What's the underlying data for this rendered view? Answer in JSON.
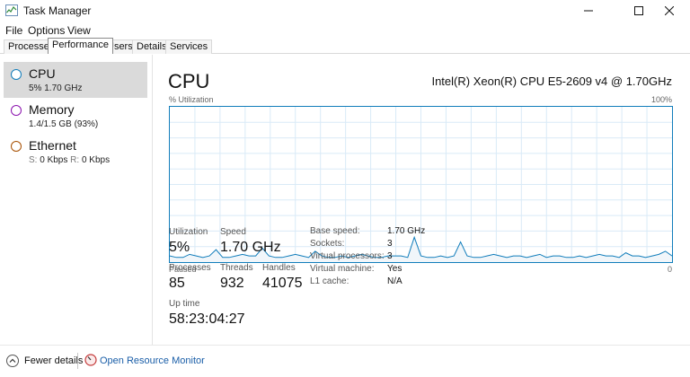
{
  "window": {
    "title": "Task Manager"
  },
  "menu": [
    "File",
    "Options",
    "View"
  ],
  "tabs": [
    {
      "label": "Processes",
      "active": false
    },
    {
      "label": "Performance",
      "active": true
    },
    {
      "label": "Users",
      "active": false
    },
    {
      "label": "Details",
      "active": false
    },
    {
      "label": "Services",
      "active": false
    }
  ],
  "resources": {
    "cpu": {
      "name": "CPU",
      "sub": "5%  1.70 GHz",
      "color": "#117dbb"
    },
    "memory": {
      "name": "Memory",
      "sub": "1.4/1.5 GB (93%)",
      "color": "#8b12ae"
    },
    "ethernet": {
      "name": "Ethernet",
      "sub_s_label": "S:",
      "sub_s": "0 Kbps",
      "sub_r_label": "R:",
      "sub_r": "0 Kbps",
      "color": "#a74f01"
    }
  },
  "main": {
    "title": "CPU",
    "model": "Intel(R) Xeon(R) CPU E5-2609 v4 @ 1.70GHz",
    "graph": {
      "top_left": "% Utilization",
      "top_right": "100%",
      "bottom_left": "Paused",
      "bottom_right": "0",
      "utilization_percent": [
        4,
        3,
        3,
        5,
        4,
        3,
        4,
        8,
        3,
        3,
        4,
        5,
        4,
        4,
        9,
        4,
        3,
        3,
        4,
        5,
        4,
        3,
        7,
        4,
        3,
        3,
        4,
        3,
        4,
        5,
        4,
        3,
        3,
        4,
        4,
        4,
        3,
        16,
        4,
        3,
        3,
        4,
        3,
        4,
        13,
        4,
        3,
        3,
        4,
        5,
        4,
        3,
        4,
        4,
        3,
        4,
        5,
        3,
        4,
        4,
        3,
        3,
        4,
        3,
        4,
        5,
        4,
        4,
        3,
        6,
        4,
        4,
        3,
        4,
        5,
        7,
        4
      ]
    },
    "stats": {
      "utilization_label": "Utilization",
      "utilization": "5%",
      "speed_label": "Speed",
      "speed": "1.70 GHz",
      "processes_label": "Processes",
      "processes": "85",
      "threads_label": "Threads",
      "threads": "932",
      "handles_label": "Handles",
      "handles": "41075",
      "uptime_label": "Up time",
      "uptime": "58:23:04:27"
    },
    "details": [
      {
        "label": "Base speed:",
        "value": "1.70 GHz"
      },
      {
        "label": "Sockets:",
        "value": "3"
      },
      {
        "label": "Virtual processors:",
        "value": "3"
      },
      {
        "label": "Virtual machine:",
        "value": "Yes"
      },
      {
        "label": "L1 cache:",
        "value": "N/A"
      }
    ]
  },
  "footer": {
    "fewer_details": "Fewer details",
    "open_monitor": "Open Resource Monitor"
  }
}
